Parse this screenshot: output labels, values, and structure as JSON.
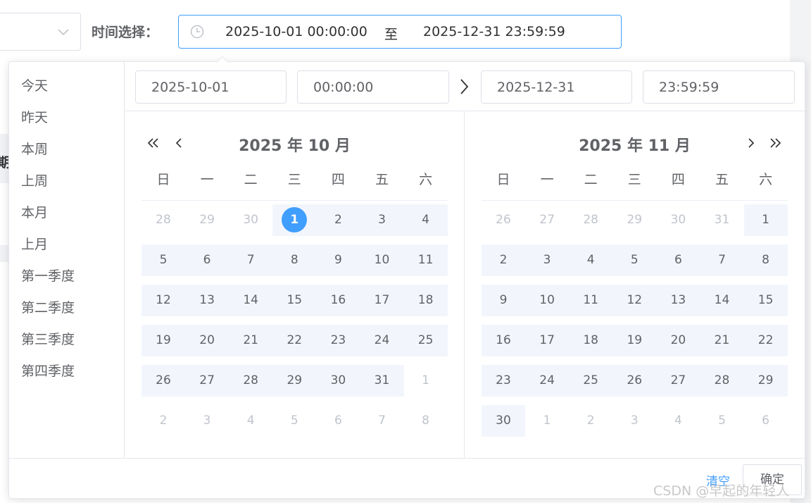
{
  "toolbar": {
    "time_label": "时间选择：",
    "range_start": "2025-10-01 00:00:00",
    "range_separator": "至",
    "range_end": "2025-12-31 23:59:59"
  },
  "background": {
    "fragment_char": "期"
  },
  "shortcuts": [
    "今天",
    "昨天",
    "本周",
    "上周",
    "本月",
    "上月",
    "第一季度",
    "第二季度",
    "第三季度",
    "第四季度"
  ],
  "header_inputs": {
    "start_date": "2025-10-01",
    "start_time": "00:00:00",
    "end_date": "2025-12-31",
    "end_time": "23:59:59"
  },
  "weekdays": [
    "日",
    "一",
    "二",
    "三",
    "四",
    "五",
    "六"
  ],
  "left_panel": {
    "title": "2025 年 10 月",
    "rows": [
      [
        {
          "d": "28",
          "o": 1
        },
        {
          "d": "29",
          "o": 1
        },
        {
          "d": "30",
          "o": 1
        },
        {
          "d": "1",
          "s": 1
        },
        {
          "d": "2"
        },
        {
          "d": "3"
        },
        {
          "d": "4"
        }
      ],
      [
        {
          "d": "5"
        },
        {
          "d": "6"
        },
        {
          "d": "7"
        },
        {
          "d": "8"
        },
        {
          "d": "9"
        },
        {
          "d": "10"
        },
        {
          "d": "11"
        }
      ],
      [
        {
          "d": "12"
        },
        {
          "d": "13"
        },
        {
          "d": "14"
        },
        {
          "d": "15"
        },
        {
          "d": "16"
        },
        {
          "d": "17"
        },
        {
          "d": "18"
        }
      ],
      [
        {
          "d": "19"
        },
        {
          "d": "20"
        },
        {
          "d": "21"
        },
        {
          "d": "22"
        },
        {
          "d": "23"
        },
        {
          "d": "24"
        },
        {
          "d": "25"
        }
      ],
      [
        {
          "d": "26"
        },
        {
          "d": "27"
        },
        {
          "d": "28"
        },
        {
          "d": "29"
        },
        {
          "d": "30"
        },
        {
          "d": "31"
        },
        {
          "d": "1",
          "o": 1
        }
      ],
      [
        {
          "d": "2",
          "o": 1
        },
        {
          "d": "3",
          "o": 1
        },
        {
          "d": "4",
          "o": 1
        },
        {
          "d": "5",
          "o": 1
        },
        {
          "d": "6",
          "o": 1
        },
        {
          "d": "7",
          "o": 1
        },
        {
          "d": "8",
          "o": 1
        }
      ]
    ]
  },
  "right_panel": {
    "title": "2025 年 11 月",
    "rows": [
      [
        {
          "d": "26",
          "o": 1
        },
        {
          "d": "27",
          "o": 1
        },
        {
          "d": "28",
          "o": 1
        },
        {
          "d": "29",
          "o": 1
        },
        {
          "d": "30",
          "o": 1
        },
        {
          "d": "31",
          "o": 1
        },
        {
          "d": "1"
        }
      ],
      [
        {
          "d": "2"
        },
        {
          "d": "3"
        },
        {
          "d": "4"
        },
        {
          "d": "5"
        },
        {
          "d": "6"
        },
        {
          "d": "7"
        },
        {
          "d": "8"
        }
      ],
      [
        {
          "d": "9"
        },
        {
          "d": "10"
        },
        {
          "d": "11"
        },
        {
          "d": "12"
        },
        {
          "d": "13"
        },
        {
          "d": "14"
        },
        {
          "d": "15"
        }
      ],
      [
        {
          "d": "16"
        },
        {
          "d": "17"
        },
        {
          "d": "18"
        },
        {
          "d": "19"
        },
        {
          "d": "20"
        },
        {
          "d": "21"
        },
        {
          "d": "22"
        }
      ],
      [
        {
          "d": "23"
        },
        {
          "d": "24"
        },
        {
          "d": "25"
        },
        {
          "d": "26"
        },
        {
          "d": "27"
        },
        {
          "d": "28"
        },
        {
          "d": "29"
        }
      ],
      [
        {
          "d": "30"
        },
        {
          "d": "1",
          "o": 1
        },
        {
          "d": "2",
          "o": 1
        },
        {
          "d": "3",
          "o": 1
        },
        {
          "d": "4",
          "o": 1
        },
        {
          "d": "5",
          "o": 1
        },
        {
          "d": "6",
          "o": 1
        }
      ]
    ]
  },
  "footer": {
    "clear_label": "清空",
    "confirm_label": "确定"
  },
  "watermark": "CSDN @早起的年轻人",
  "colors": {
    "accent": "#409eff",
    "in_range_bg": "#f2f6fc",
    "text": "#606266",
    "muted": "#c0c4cc"
  }
}
